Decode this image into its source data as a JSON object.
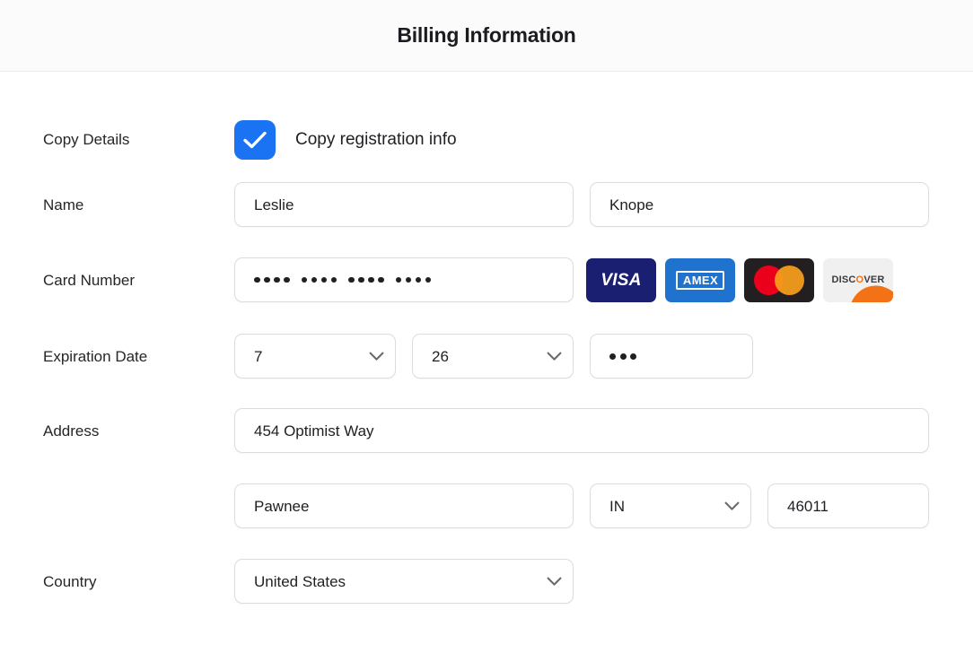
{
  "header": {
    "title": "Billing Information"
  },
  "form": {
    "copy_details": {
      "label": "Copy Details",
      "checkbox_label": "Copy registration info",
      "checked": true,
      "accent_color": "#1a73f2"
    },
    "name": {
      "label": "Name",
      "first_value": "Leslie",
      "last_value": "Knope"
    },
    "card_number": {
      "label": "Card Number",
      "masked_value": "•••• •••• •••• ••••",
      "accepted_cards": [
        {
          "name": "visa-card-logo",
          "text": "VISA",
          "bg": "#1a1f71",
          "fg": "#ffffff"
        },
        {
          "name": "amex-card-logo",
          "text": "AMEX",
          "bg": "#1f72cd",
          "fg": "#ffffff"
        },
        {
          "name": "mastercard-card-logo",
          "text": "",
          "bg": "#231f20",
          "fg": "#eb001b"
        },
        {
          "name": "discover-card-logo",
          "text": "DISCOVER",
          "bg": "#f0f0f0",
          "fg": "#3b3b3f"
        }
      ]
    },
    "expiration_date": {
      "label": "Expiration Date",
      "month_value": "7",
      "year_value": "26",
      "cvv_masked": "•••"
    },
    "address": {
      "label": "Address",
      "street_value": "454 Optimist Way",
      "city_value": "Pawnee",
      "state_value": "IN",
      "zip_value": "46011"
    },
    "country": {
      "label": "Country",
      "value": "United States"
    }
  }
}
